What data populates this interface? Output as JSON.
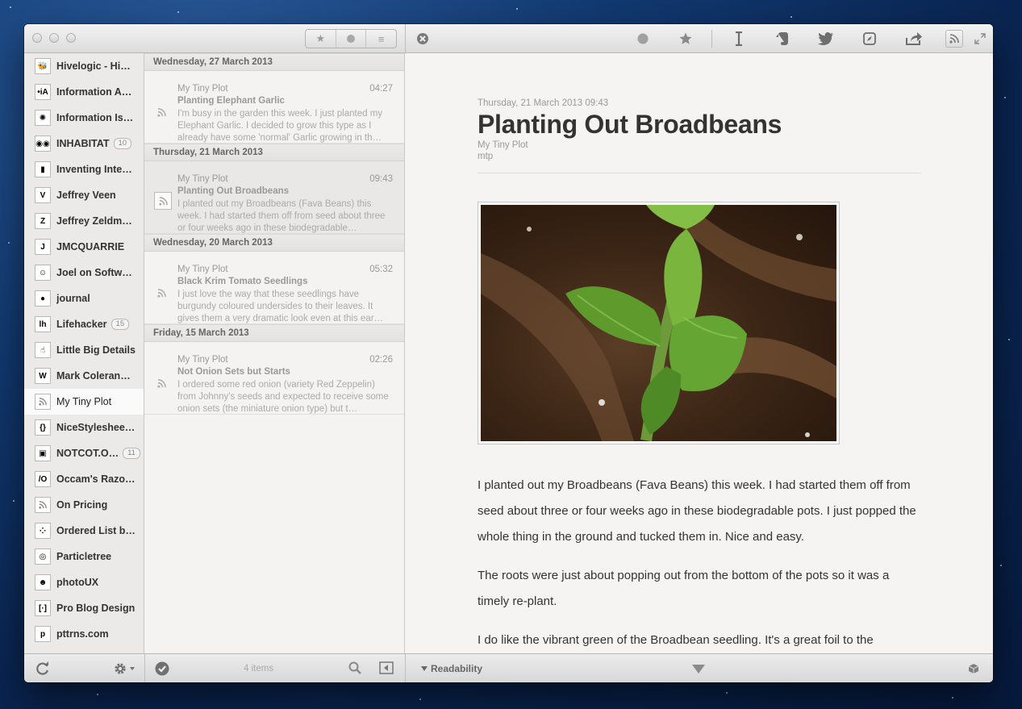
{
  "toolbar": {
    "filter_starred": "★",
    "filter_unread": "unread",
    "filter_all": "≡",
    "icons": [
      "close-circle-icon",
      "mark-unread-icon",
      "star-icon",
      "instapaper-icon",
      "evernote-icon",
      "twitter-icon",
      "safari-icon",
      "share-icon",
      "rss-icon",
      "fullscreen-icon"
    ]
  },
  "sidebar": {
    "feeds": [
      {
        "name": "Hivelogic - Hiv…",
        "icon": "🐝",
        "count": ""
      },
      {
        "name": "Information Ar…",
        "icon": "•iA",
        "count": ""
      },
      {
        "name": "Information Is…",
        "icon": "✺",
        "count": ""
      },
      {
        "name": "INHABITAT",
        "icon": "◉◉",
        "count": "10"
      },
      {
        "name": "Inventing Inter…",
        "icon": "▮",
        "count": ""
      },
      {
        "name": "Jeffrey Veen",
        "icon": "V",
        "count": ""
      },
      {
        "name": "Jeffrey Zeldma…",
        "icon": "Z",
        "count": ""
      },
      {
        "name": "JMCQUARRIE",
        "icon": "J",
        "count": ""
      },
      {
        "name": "Joel on Software",
        "icon": "☺",
        "count": ""
      },
      {
        "name": "journal",
        "icon": "●",
        "count": ""
      },
      {
        "name": "Lifehacker",
        "icon": "lh",
        "count": "15"
      },
      {
        "name": "Little Big Details",
        "icon": "☝",
        "count": ""
      },
      {
        "name": "Mark Coleran…",
        "icon": "W",
        "count": ""
      },
      {
        "name": "My Tiny Plot",
        "icon": "rss",
        "count": ""
      },
      {
        "name": "NiceStylesheet…",
        "icon": "{}",
        "count": ""
      },
      {
        "name": "NOTCOT.O…",
        "icon": "▣",
        "count": "11"
      },
      {
        "name": "Occam's Razo…",
        "icon": "/O",
        "count": ""
      },
      {
        "name": "On Pricing",
        "icon": "rss",
        "count": ""
      },
      {
        "name": "Ordered List b…",
        "icon": "⁘",
        "count": ""
      },
      {
        "name": "Particletree",
        "icon": "◎",
        "count": ""
      },
      {
        "name": "photoUX",
        "icon": "☻",
        "count": ""
      },
      {
        "name": "Pro Blog Design",
        "icon": "[·]",
        "count": ""
      },
      {
        "name": "pttrns.com",
        "icon": "p",
        "count": ""
      }
    ],
    "selected_index": 13
  },
  "list": {
    "groups": [
      {
        "date": "Wednesday, 27 March 2013",
        "article": {
          "source": "My Tiny Plot",
          "time": "04:27",
          "title": "Planting Elephant Garlic",
          "summary": "I'm busy in the garden this week. I just planted my Elephant Garlic. I decided to grow this type as I already have some 'normal' Garlic growing in th…"
        }
      },
      {
        "date": "Thursday, 21 March 2013",
        "article": {
          "source": "My Tiny Plot",
          "time": "09:43",
          "title": "Planting Out Broadbeans",
          "summary": "I planted out my Broadbeans (Fava Beans) this week. I had started them off from seed about three or four weeks ago in these biodegradable…"
        }
      },
      {
        "date": "Wednesday, 20 March 2013",
        "article": {
          "source": "My Tiny Plot",
          "time": "05:32",
          "title": "Black Krim Tomato Seedlings",
          "summary": "I just love the way that these seedlings have burgundy coloured undersides to their leaves. It gives them a very dramatic look even at this ear…"
        }
      },
      {
        "date": "Friday, 15 March 2013",
        "article": {
          "source": "My Tiny Plot",
          "time": "02:26",
          "title": "Not Onion Sets but Starts",
          "summary": "I ordered some red onion (variety Red Zeppelin) from Johnny's seeds and expected to receive some onion sets (the miniature onion type) but t…"
        }
      }
    ],
    "selected_index": 1
  },
  "reader": {
    "datetime": "Thursday, 21 March 2013 09:43",
    "title": "Planting Out Broadbeans",
    "source": "My Tiny Plot",
    "author": "mtp",
    "paragraphs": [
      "I planted out my Broadbeans (Fava Beans) this week. I had started them off from seed about three or four weeks ago in these biodegradable pots. I just popped the whole thing in the ground and tucked them in. Nice and easy.",
      "The roots were just about popping out from the bottom of the pots so it was a timely re-plant.",
      "I do like the vibrant green of the Broadbean seedling. It's a great foil to the"
    ]
  },
  "bottombar": {
    "items_count": "4 items",
    "readability_label": "Readability"
  },
  "colors": {
    "window_bg": "#f4f3f1",
    "sidebar_bg": "#ebeae8",
    "title_text": "#333333",
    "muted_text": "#999999"
  }
}
